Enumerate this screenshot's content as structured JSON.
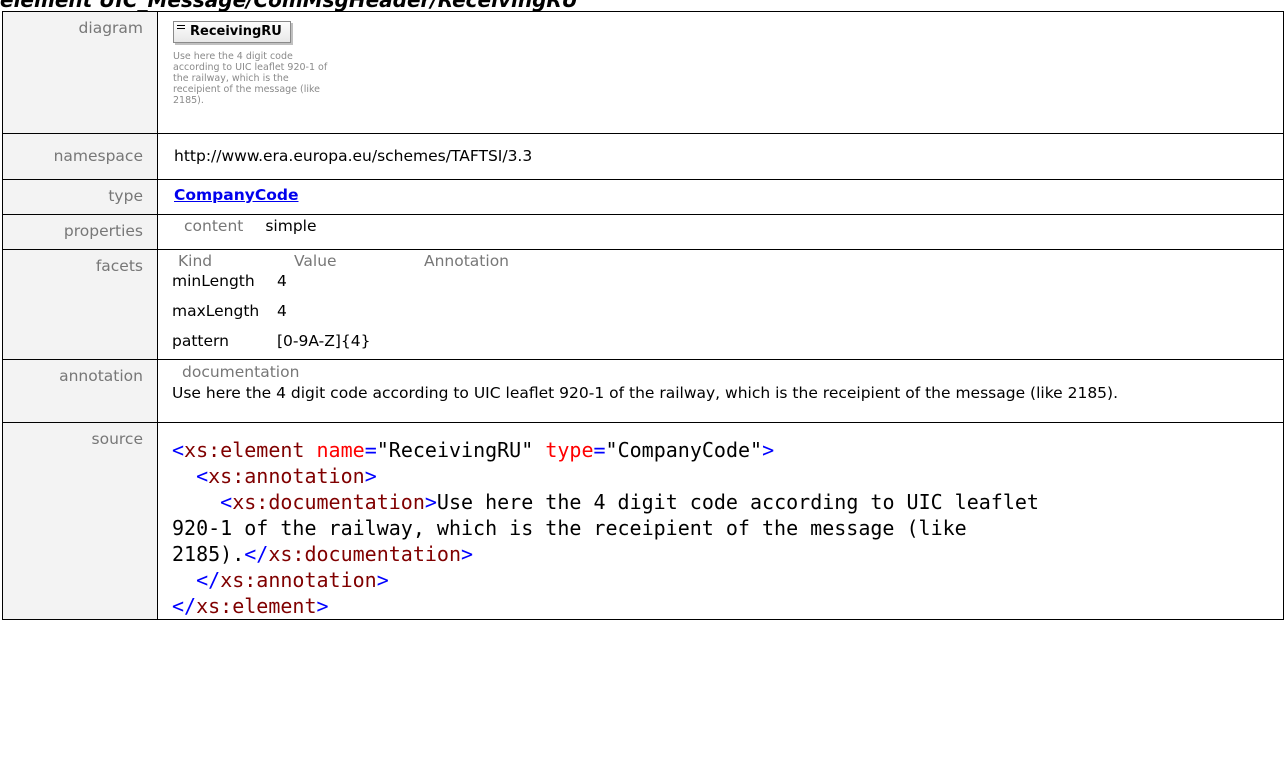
{
  "header": {
    "title": "element UIC_Message/ComMsgHeader/ReceivingRU"
  },
  "rows": {
    "diagram": {
      "label": "diagram",
      "box_label": "ReceivingRU",
      "box_text": "Use here the 4 digit code according to UIC leaflet 920-1 of the railway, which is the receipient of the message (like 2185)."
    },
    "namespace": {
      "label": "namespace",
      "value": "http://www.era.europa.eu/schemes/TAFTSI/3.3"
    },
    "type": {
      "label": "type",
      "value": "CompanyCode"
    },
    "properties": {
      "label": "properties",
      "key": "content",
      "value": "simple"
    },
    "facets": {
      "label": "facets",
      "headers": [
        "Kind",
        "Value",
        "Annotation"
      ],
      "items": [
        {
          "kind": "minLength",
          "value": "4"
        },
        {
          "kind": "maxLength",
          "value": "4"
        },
        {
          "kind": "pattern",
          "value": "[0-9A-Z]{4}"
        }
      ]
    },
    "annotation": {
      "label": "annotation",
      "sub": "documentation",
      "text": "Use here the 4 digit code according to UIC leaflet 920-1 of the railway, which is the receipient of the message (like 2185)."
    },
    "source": {
      "label": "source",
      "name_value": "\"ReceivingRU\"",
      "type_value": "\"CompanyCode\"",
      "doc_text": "Use here the 4 digit code according to UIC leaflet\n920-1 of the railway, which is the receipient of the message (like\n2185)."
    }
  }
}
